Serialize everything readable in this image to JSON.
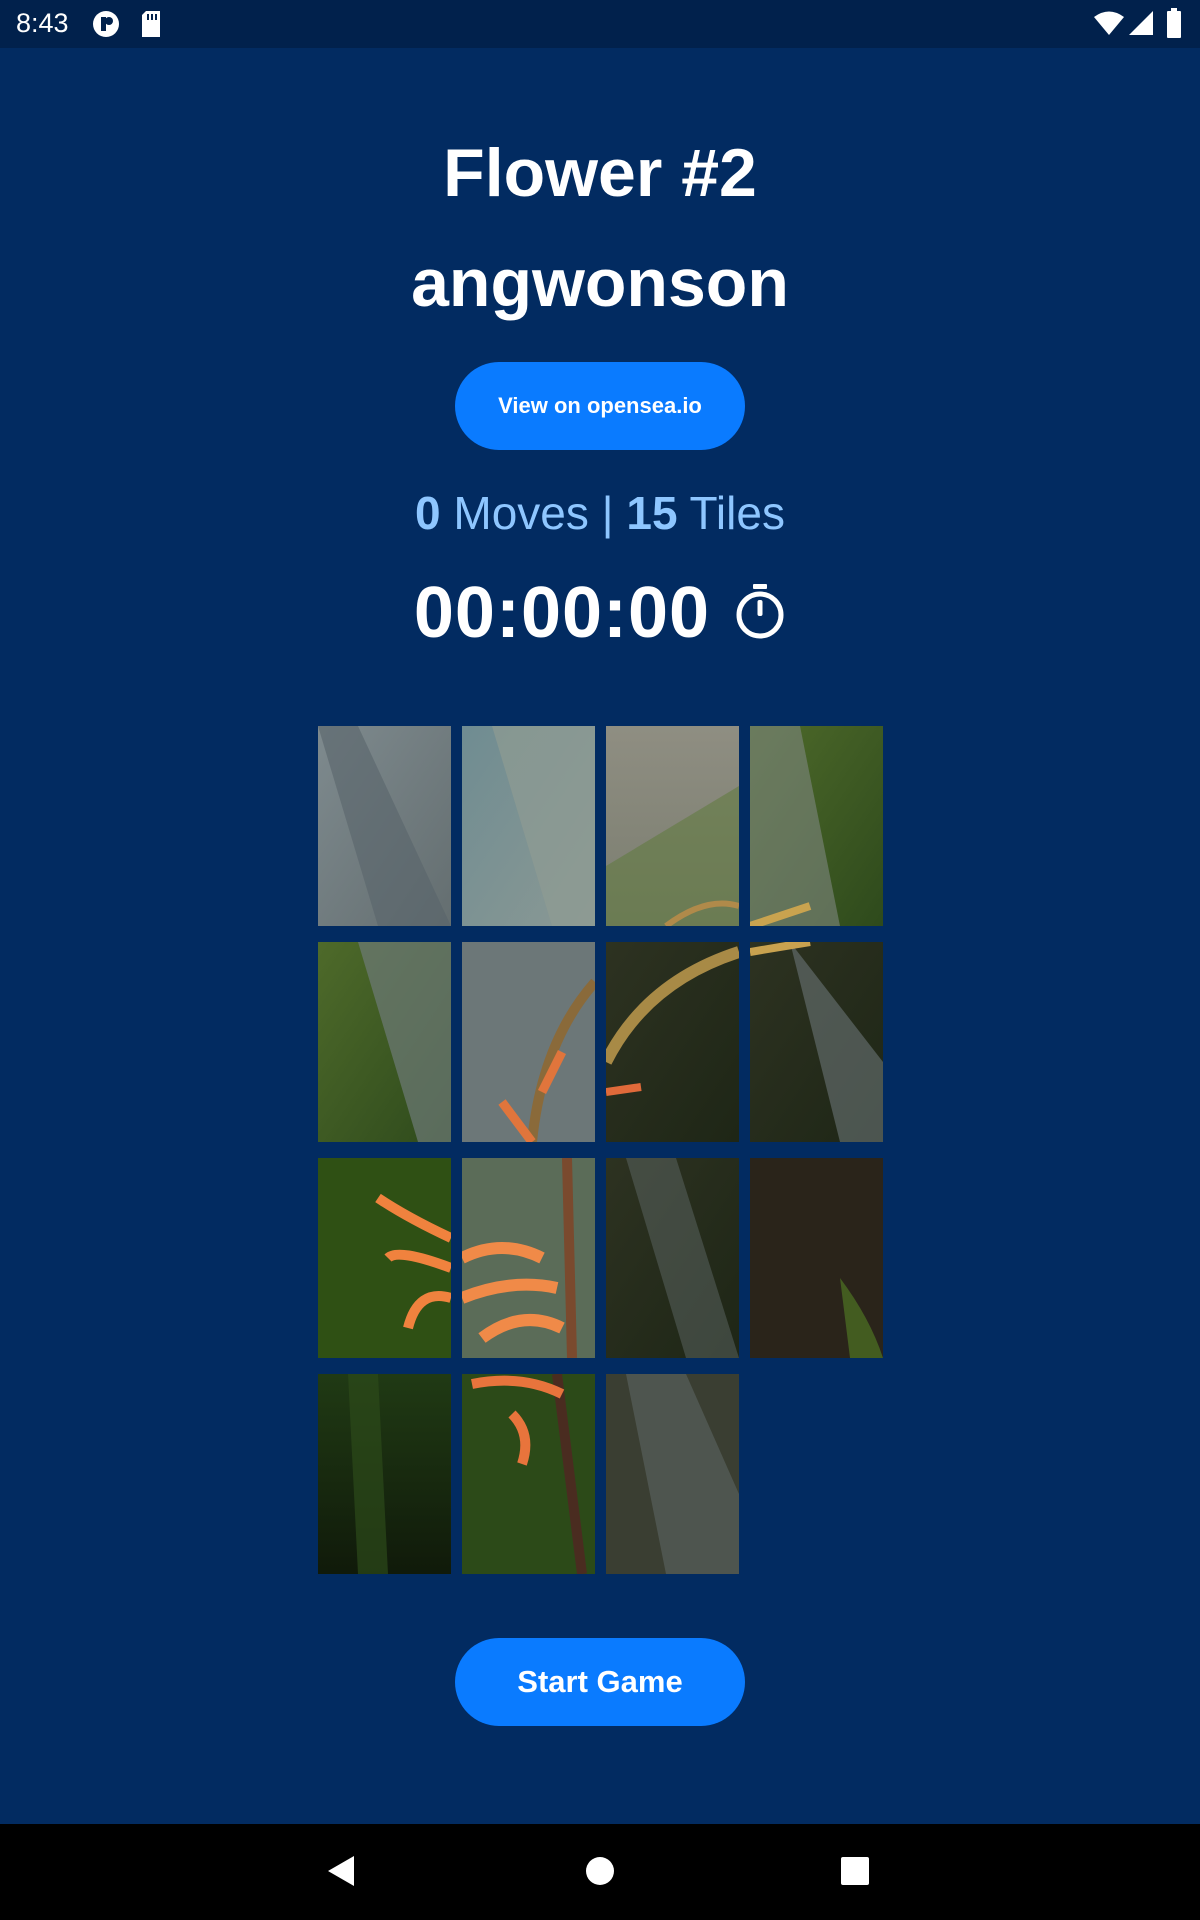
{
  "status_bar": {
    "time": "8:43",
    "left_icons": [
      "app-notification-icon",
      "sd-card-icon"
    ],
    "right_icons": [
      "wifi-icon",
      "cell-signal-icon",
      "battery-icon"
    ]
  },
  "header": {
    "title": "Flower #2",
    "author": "angwonson"
  },
  "opensea_button": {
    "label": "View on opensea.io"
  },
  "stats": {
    "moves": "0",
    "moves_label": "Moves",
    "separator": "|",
    "tiles": "15",
    "tiles_label": "Tiles"
  },
  "timer": {
    "value": "00:00:00",
    "icon": "stopwatch-icon"
  },
  "puzzle": {
    "grid": "4x4",
    "tile_count": 15,
    "empty_slot": "bottom-right"
  },
  "start_button": {
    "label": "Start Game"
  },
  "nav_bar": {
    "icons": [
      "back-icon",
      "home-icon",
      "recents-icon"
    ]
  },
  "colors": {
    "background": "#022B61",
    "status_bar": "#01214C",
    "accent": "#0A7BFF",
    "stats_text": "#8EC6FF"
  }
}
